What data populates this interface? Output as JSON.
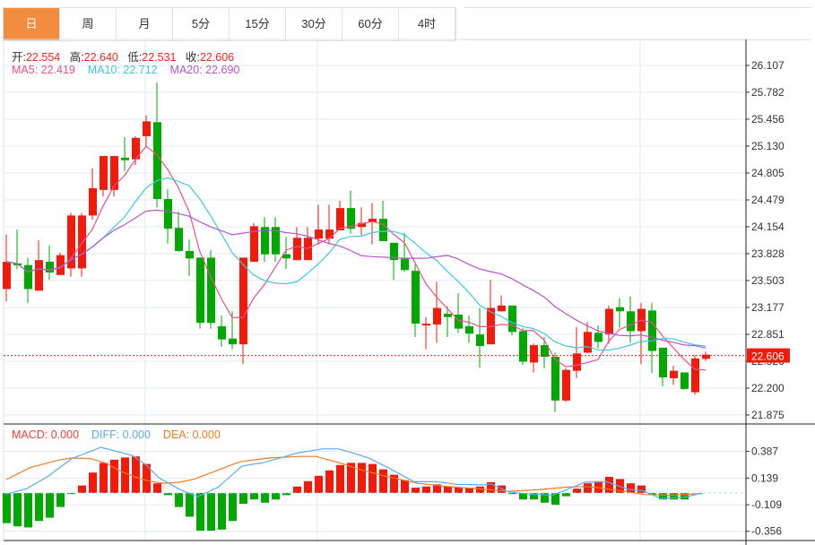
{
  "tabs": [
    {
      "label": "日",
      "active": true
    },
    {
      "label": "周"
    },
    {
      "label": "月"
    },
    {
      "label": "5分"
    },
    {
      "label": "15分"
    },
    {
      "label": "30分"
    },
    {
      "label": "60分"
    },
    {
      "label": "4时"
    }
  ],
  "ohlc_info": {
    "open_label": "开:",
    "open": "22.554",
    "high_label": "高:",
    "high": "22.640",
    "low_label": "低:",
    "low": "22.531",
    "close_label": "收:",
    "close": "22.606"
  },
  "ma_info": {
    "ma5": "MA5: 22.419",
    "ma10": "MA10: 22.712",
    "ma20": "MA20: 22.690"
  },
  "macd_info": {
    "macd": "MACD: 0.000",
    "diff": "DIFF: 0.000",
    "dea": "DEA: 0.000"
  },
  "colors": {
    "up": "#f21a0a",
    "down": "#00a800",
    "ma5": "#ee4f8a",
    "ma10": "#3cc8e0",
    "ma20": "#b455c8",
    "diff": "#5aaaf0",
    "dea": "#f57a20",
    "accent": "#f28c3e"
  },
  "chart_data": [
    {
      "type": "candlestick",
      "title": "K-line (daily)",
      "y_ticks": [
        "26.107",
        "25.782",
        "25.456",
        "25.130",
        "24.805",
        "24.479",
        "24.154",
        "23.828",
        "23.503",
        "23.177",
        "22.851",
        "22.526",
        "22.200",
        "21.875"
      ],
      "ylim": [
        21.875,
        26.107
      ],
      "current_price": "22.606",
      "candles_ohlc": [
        [
          23.4,
          24.06,
          23.25,
          23.73
        ],
        [
          23.71,
          24.12,
          23.64,
          23.69
        ],
        [
          23.69,
          23.78,
          23.23,
          23.4
        ],
        [
          23.38,
          23.99,
          23.38,
          23.75
        ],
        [
          23.73,
          23.93,
          23.51,
          23.6
        ],
        [
          23.57,
          23.84,
          23.57,
          23.81
        ],
        [
          23.65,
          24.32,
          23.55,
          24.29
        ],
        [
          23.65,
          24.32,
          23.55,
          24.29
        ],
        [
          24.29,
          24.86,
          24.24,
          24.62
        ],
        [
          24.6,
          25.01,
          24.52,
          25.01
        ],
        [
          24.6,
          25.01,
          24.52,
          25.01
        ],
        [
          24.99,
          25.24,
          24.83,
          24.96
        ],
        [
          24.97,
          25.25,
          24.9,
          25.23
        ],
        [
          25.25,
          25.5,
          25.13,
          25.43
        ],
        [
          25.42,
          25.9,
          24.39,
          24.49
        ],
        [
          24.49,
          24.61,
          23.95,
          24.13
        ],
        [
          24.14,
          24.34,
          23.85,
          23.86
        ],
        [
          23.86,
          24.0,
          23.56,
          23.77
        ],
        [
          23.78,
          23.78,
          22.92,
          22.99
        ],
        [
          23.78,
          23.87,
          22.92,
          22.99
        ],
        [
          22.95,
          23.08,
          22.7,
          22.79
        ],
        [
          22.8,
          23.13,
          22.67,
          22.73
        ],
        [
          22.73,
          23.78,
          22.49,
          23.78
        ],
        [
          23.73,
          24.2,
          23.73,
          24.16
        ],
        [
          24.15,
          24.27,
          23.73,
          23.82
        ],
        [
          24.15,
          24.27,
          23.73,
          23.82
        ],
        [
          23.82,
          24.03,
          23.64,
          23.77
        ],
        [
          23.75,
          24.15,
          23.75,
          24.02
        ],
        [
          23.75,
          24.15,
          23.75,
          24.02
        ],
        [
          24.01,
          24.42,
          23.94,
          24.12
        ],
        [
          24.01,
          24.42,
          23.94,
          24.12
        ],
        [
          24.11,
          24.47,
          24.11,
          24.38
        ],
        [
          24.38,
          24.59,
          24.07,
          24.13
        ],
        [
          24.15,
          24.39,
          24.05,
          24.2
        ],
        [
          24.21,
          24.44,
          23.94,
          24.25
        ],
        [
          24.25,
          24.47,
          23.98,
          23.98
        ],
        [
          23.96,
          23.96,
          23.51,
          23.75
        ],
        [
          23.77,
          24.08,
          23.61,
          23.63
        ],
        [
          23.62,
          23.7,
          22.82,
          22.98
        ],
        [
          22.96,
          23.06,
          22.67,
          22.98
        ],
        [
          22.97,
          23.49,
          22.75,
          23.17
        ],
        [
          23.1,
          23.19,
          22.82,
          23.06
        ],
        [
          23.09,
          23.35,
          22.87,
          22.92
        ],
        [
          22.95,
          23.08,
          22.75,
          22.86
        ],
        [
          22.85,
          23.17,
          22.45,
          22.71
        ],
        [
          22.73,
          23.51,
          22.73,
          23.17
        ],
        [
          23.13,
          23.32,
          23.13,
          23.2
        ],
        [
          23.2,
          23.2,
          22.84,
          22.88
        ],
        [
          22.89,
          22.93,
          22.48,
          22.52
        ],
        [
          22.51,
          22.74,
          22.39,
          22.72
        ],
        [
          22.72,
          22.82,
          22.44,
          22.58
        ],
        [
          22.58,
          22.63,
          21.91,
          22.05
        ],
        [
          22.05,
          22.44,
          22.03,
          22.42
        ],
        [
          22.41,
          22.94,
          22.32,
          22.62
        ],
        [
          22.63,
          23.0,
          22.62,
          22.88
        ],
        [
          22.87,
          22.96,
          22.68,
          22.76
        ],
        [
          22.85,
          23.2,
          22.74,
          23.16
        ],
        [
          23.18,
          23.29,
          22.93,
          23.13
        ],
        [
          23.13,
          23.31,
          22.75,
          22.89
        ],
        [
          22.89,
          23.23,
          22.49,
          23.16
        ],
        [
          23.14,
          23.23,
          22.38,
          22.65
        ],
        [
          22.69,
          22.69,
          22.22,
          22.33
        ],
        [
          22.32,
          22.47,
          22.24,
          22.41
        ],
        [
          22.39,
          22.39,
          22.18,
          22.19
        ],
        [
          22.15,
          22.6,
          22.12,
          22.56
        ],
        [
          22.554,
          22.64,
          22.531,
          22.606
        ]
      ],
      "series": [
        {
          "name": "MA5",
          "period": 5
        },
        {
          "name": "MA10",
          "period": 10
        },
        {
          "name": "MA20",
          "period": 20
        }
      ]
    },
    {
      "type": "bar+line",
      "title": "MACD",
      "y_ticks": [
        "0.387",
        "0.139",
        "-0.109",
        "-0.356"
      ],
      "ylim": [
        -0.356,
        0.387
      ],
      "histogram": [
        -0.28,
        -0.31,
        -0.32,
        -0.26,
        -0.23,
        -0.13,
        -0.01,
        0.07,
        0.19,
        0.28,
        0.31,
        0.33,
        0.34,
        0.27,
        0.09,
        -0.02,
        -0.13,
        -0.22,
        -0.35,
        -0.35,
        -0.34,
        -0.26,
        -0.1,
        -0.06,
        -0.09,
        -0.06,
        -0.02,
        0.06,
        0.11,
        0.16,
        0.21,
        0.26,
        0.28,
        0.28,
        0.27,
        0.22,
        0.17,
        0.12,
        0.05,
        0.06,
        0.08,
        0.06,
        0.05,
        0.05,
        0.06,
        0.1,
        0.07,
        -0.01,
        -0.06,
        -0.06,
        -0.09,
        -0.11,
        -0.03,
        0.04,
        0.09,
        0.11,
        0.15,
        0.13,
        0.09,
        0.07,
        -0.02,
        -0.06,
        -0.06,
        -0.06,
        0,
        0
      ],
      "diff_points": [
        [
          0,
          -0.01
        ],
        [
          1.9,
          0.04
        ],
        [
          3.8,
          0.15
        ],
        [
          6.1,
          0.32
        ],
        [
          8.8,
          0.425
        ],
        [
          11.7,
          0.35
        ],
        [
          13,
          0.26
        ],
        [
          14.2,
          0.14
        ],
        [
          16.1,
          0.035
        ],
        [
          17.8,
          -0.035
        ],
        [
          19.7,
          0.055
        ],
        [
          21.9,
          0.25
        ],
        [
          23,
          0.27
        ],
        [
          23.8,
          0.28
        ],
        [
          27.2,
          0.375
        ],
        [
          29.4,
          0.41
        ],
        [
          30.9,
          0.41
        ],
        [
          32.8,
          0.355
        ],
        [
          33.8,
          0.32
        ],
        [
          35.5,
          0.235
        ],
        [
          37.9,
          0.105
        ],
        [
          40,
          0.105
        ],
        [
          41.9,
          0.08
        ],
        [
          44.4,
          0.075
        ],
        [
          45,
          0.085
        ],
        [
          46.7,
          0.01
        ],
        [
          48.6,
          -0.01
        ],
        [
          50.8,
          -0.02
        ],
        [
          52.2,
          0.035
        ],
        [
          53.8,
          0.1
        ],
        [
          55.8,
          0.105
        ],
        [
          57.8,
          0.035
        ],
        [
          59.2,
          0.02
        ],
        [
          60.8,
          -0.05
        ],
        [
          63,
          -0.04
        ],
        [
          64.7,
          0
        ]
      ],
      "dea_points": [
        [
          0,
          0.125
        ],
        [
          2.2,
          0.236
        ],
        [
          5,
          0.31
        ],
        [
          6.1,
          0.325
        ],
        [
          7.8,
          0.32
        ],
        [
          9.2,
          0.28
        ],
        [
          10.5,
          0.21
        ],
        [
          11.9,
          0.15
        ],
        [
          13.3,
          0.11
        ],
        [
          14.7,
          0.09
        ],
        [
          16.1,
          0.1
        ],
        [
          17.5,
          0.13
        ],
        [
          18.8,
          0.18
        ],
        [
          21.7,
          0.29
        ],
        [
          24.4,
          0.325
        ],
        [
          27.2,
          0.34
        ],
        [
          28.8,
          0.34
        ],
        [
          31.3,
          0.27
        ],
        [
          32.8,
          0.22
        ],
        [
          35.5,
          0.15
        ],
        [
          38.3,
          0.09
        ],
        [
          41.1,
          0.06
        ],
        [
          43.8,
          0.04
        ],
        [
          46.7,
          0.015
        ],
        [
          49.4,
          0.03
        ],
        [
          52.2,
          0.055
        ],
        [
          53.6,
          0.06
        ],
        [
          55,
          0.05
        ],
        [
          57.8,
          0.01
        ],
        [
          59.4,
          -0.015
        ],
        [
          61.9,
          -0.02
        ],
        [
          64.7,
          -0.005
        ]
      ]
    }
  ]
}
